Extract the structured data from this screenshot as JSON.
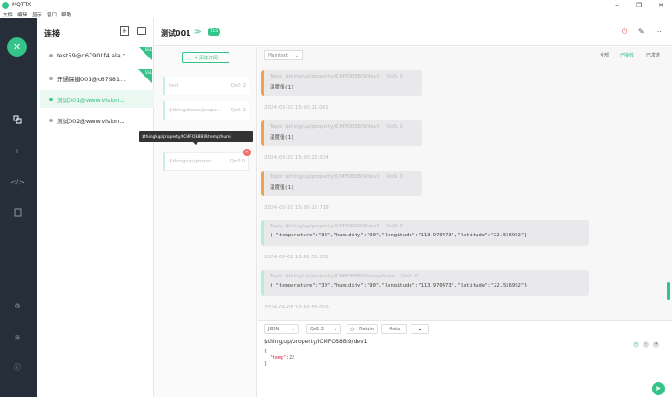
{
  "window": {
    "title": "MQTTX",
    "minimize": "–",
    "maximize": "❐",
    "close": "✕"
  },
  "menu": [
    "文件",
    "编辑",
    "显示",
    "窗口",
    "帮助"
  ],
  "rail": {
    "logo": "✕",
    "icons": [
      "connections-icon",
      "add-icon",
      "script-icon",
      "log-icon",
      "settings-icon",
      "about-icon",
      "info-icon"
    ]
  },
  "connections": {
    "header": "连接",
    "add": "+",
    "items": [
      {
        "name": "test59@c67901f4.ala.c...",
        "ssl": "SSL"
      },
      {
        "name": "开通保键001@c67981...",
        "ssl": "SSL"
      },
      {
        "name": "测试001@www.vision...",
        "ssl": ""
      },
      {
        "name": "测试002@www.vision...",
        "ssl": ""
      }
    ]
  },
  "main": {
    "title": "测试001",
    "chevron": "≫",
    "badge": "TLS",
    "power": "⏻",
    "edit": "✎",
    "more": "⋯"
  },
  "topics": {
    "new_button": "+ 添加订阅",
    "items": [
      {
        "topic": "test",
        "qos": "QoS 2"
      },
      {
        "topic": "$thing/down/prope...",
        "qos": "QoS 2"
      },
      {
        "topic": "$thing/up/proper...",
        "qos": "QoS 0"
      }
    ],
    "tooltip": "$thing/up/property/ICMFOB8BI9/temp/humi",
    "close": "✕"
  },
  "filter": {
    "format": "Plaintext",
    "tabs": [
      "全部",
      "已接收",
      "已发送"
    ]
  },
  "messages": [
    {
      "topic": "Topic: $thing/up/property/ICMFOB8BI9/dev1",
      "qos": "QoS: 0",
      "payload": "温度值(1)",
      "time": "2024-03-20 15:30:11:061"
    },
    {
      "topic": "Topic: $thing/up/property/ICMFOB8BI9/dev1",
      "qos": "QoS: 0",
      "payload": "温度值(1)",
      "time": "2024-03-20 15:30:12:334"
    },
    {
      "topic": "Topic: $thing/up/property/ICMFOB8BI9/dev1",
      "qos": "QoS: 0",
      "payload": "温度值(1)",
      "time": "2024-03-20 15:30:12:718"
    },
    {
      "topic": "Topic: $thing/up/property/ICMFOB8BI9/dev1",
      "qos": "QoS: 0",
      "payload": "{ \"temperature\":\"30\",\"humidity\":\"90\",\"longitude\":\"113.970473\",\"latitude\":\"22.556992\"}",
      "time": "2024-04-08 10:42:55:311"
    },
    {
      "topic": "Topic: $thing/up/property/ICMFOB8BI9/temp/humi",
      "qos": "QoS: 0",
      "payload": "{ \"temperature\":\"30\",\"humidity\":\"90\",\"longitude\":\"113.970473\",\"latitude\":\"22.556992\"}",
      "time": "2024-04-08 10:49:58:099"
    }
  ],
  "compose": {
    "format": "JSON",
    "qos": "QoS 2",
    "retain": "Retain",
    "meta": "Meta",
    "topic": "$thing/up/property/ICMFOB8BI9/dev1",
    "payload_open": "{",
    "payload_key": "\"temp\"",
    "payload_value": ":22",
    "payload_close": "}",
    "send": "➤"
  },
  "colors": {
    "accent": "#34c388",
    "rail": "#262e3a",
    "warn": "#f0a050",
    "danger": "#f56c6c"
  }
}
